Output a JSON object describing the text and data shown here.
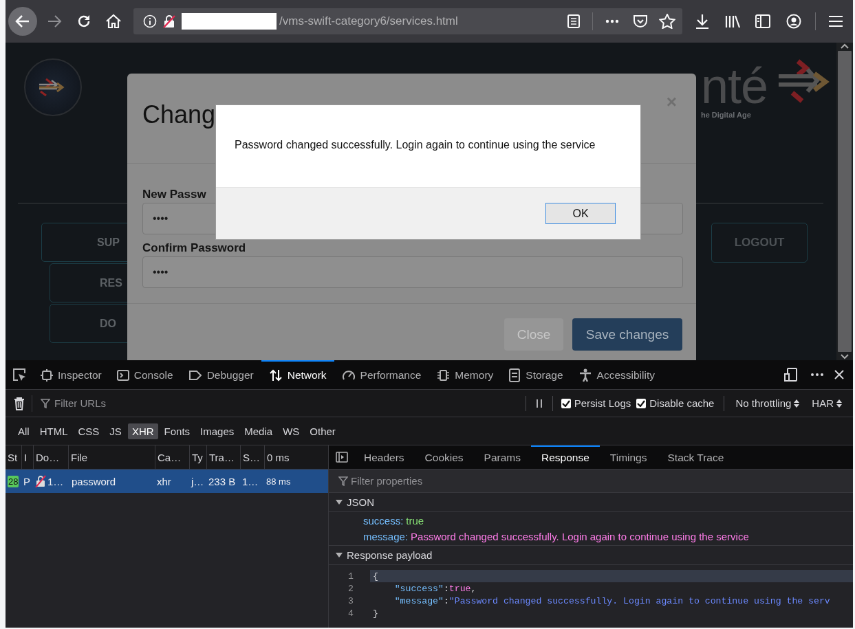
{
  "browser": {
    "url": "/vms-swift-category6/services.html"
  },
  "page": {
    "logo_text": "nté",
    "tagline": "he Digital Age",
    "nav_buttons": [
      {
        "label": "SUP"
      },
      {
        "label": "RES"
      },
      {
        "label": "DO"
      }
    ],
    "logout": "LOGOUT"
  },
  "modal": {
    "title": "Chang",
    "close": "×",
    "fields": [
      {
        "label": "New Passw",
        "value": "••••"
      },
      {
        "label": "Confirm Password",
        "value": "••••"
      }
    ],
    "buttons": [
      {
        "label": "Close",
        "kind": "secondary"
      },
      {
        "label": "Save changes",
        "kind": "primary"
      }
    ]
  },
  "alert": {
    "message": "Password changed successfully. Login again to continue using the service",
    "button": "OK"
  },
  "devtools": {
    "tabs": [
      {
        "label": "Inspector",
        "kind": "inspector",
        "selected": false
      },
      {
        "label": "Console",
        "kind": "console",
        "selected": false
      },
      {
        "label": "Debugger",
        "kind": "debugger",
        "selected": false
      },
      {
        "label": "Network",
        "kind": "network",
        "selected": true
      },
      {
        "label": "Performance",
        "kind": "performance",
        "selected": false
      },
      {
        "label": "Memory",
        "kind": "memory",
        "selected": false
      },
      {
        "label": "Storage",
        "kind": "storage",
        "selected": false
      },
      {
        "label": "Accessibility",
        "kind": "accessibility",
        "selected": false
      }
    ],
    "filter_placeholder": "Filter URLs",
    "options": [
      {
        "label": "Persist Logs",
        "checked": true
      },
      {
        "label": "Disable cache",
        "checked": true
      }
    ],
    "throttling": "No throttling",
    "har": "HAR",
    "type_filters": [
      {
        "label": "All",
        "selected": false
      },
      {
        "label": "HTML",
        "selected": false
      },
      {
        "label": "CSS",
        "selected": false
      },
      {
        "label": "JS",
        "selected": false
      },
      {
        "label": "XHR",
        "selected": true
      },
      {
        "label": "Fonts",
        "selected": false
      },
      {
        "label": "Images",
        "selected": false
      },
      {
        "label": "Media",
        "selected": false
      },
      {
        "label": "WS",
        "selected": false
      },
      {
        "label": "Other",
        "selected": false
      }
    ],
    "table": {
      "columns": [
        "St",
        "I",
        "Do…",
        "File",
        "Ca…",
        "Ty",
        "Tra…",
        "S…",
        "0 ms"
      ],
      "rows": [
        {
          "status": "28",
          "method": "P",
          "domain": "1…",
          "file": "password",
          "cause": "xhr",
          "type": "j…",
          "transferred": "233 B",
          "size": "1…",
          "timing": "88 ms",
          "selected": true
        }
      ]
    },
    "details": {
      "tabs": [
        {
          "label": "Headers",
          "selected": false
        },
        {
          "label": "Cookies",
          "selected": false
        },
        {
          "label": "Params",
          "selected": false
        },
        {
          "label": "Response",
          "selected": true
        },
        {
          "label": "Timings",
          "selected": false
        },
        {
          "label": "Stack Trace",
          "selected": false
        }
      ],
      "filter_placeholder": "Filter properties",
      "json_section": {
        "title": "JSON",
        "expanded": true,
        "properties": [
          {
            "key": "success:",
            "value": "true",
            "kind": "boolean"
          },
          {
            "key": "message:",
            "value": "Password changed successfully. Login again to continue using the service",
            "kind": "string"
          }
        ]
      },
      "payload_section": {
        "title": "Response payload",
        "expanded": true,
        "lines": [
          {
            "number": "1",
            "selected": true,
            "segments": [
              {
                "kind": "punct",
                "text": "{"
              }
            ]
          },
          {
            "number": "2",
            "selected": false,
            "segments": [
              {
                "kind": "key",
                "text": "    \"success\""
              },
              {
                "kind": "punct",
                "text": ":"
              },
              {
                "kind": "literal",
                "text": "true"
              },
              {
                "kind": "punct",
                "text": ","
              }
            ]
          },
          {
            "number": "3",
            "selected": false,
            "segments": [
              {
                "kind": "key",
                "text": "    \"message\""
              },
              {
                "kind": "punct",
                "text": ":"
              },
              {
                "kind": "string",
                "text": "\"Password changed successfully. Login again to continue using the serv"
              }
            ]
          },
          {
            "number": "4",
            "selected": false,
            "segments": [
              {
                "kind": "punct",
                "text": "}"
              }
            ]
          }
        ]
      }
    }
  }
}
